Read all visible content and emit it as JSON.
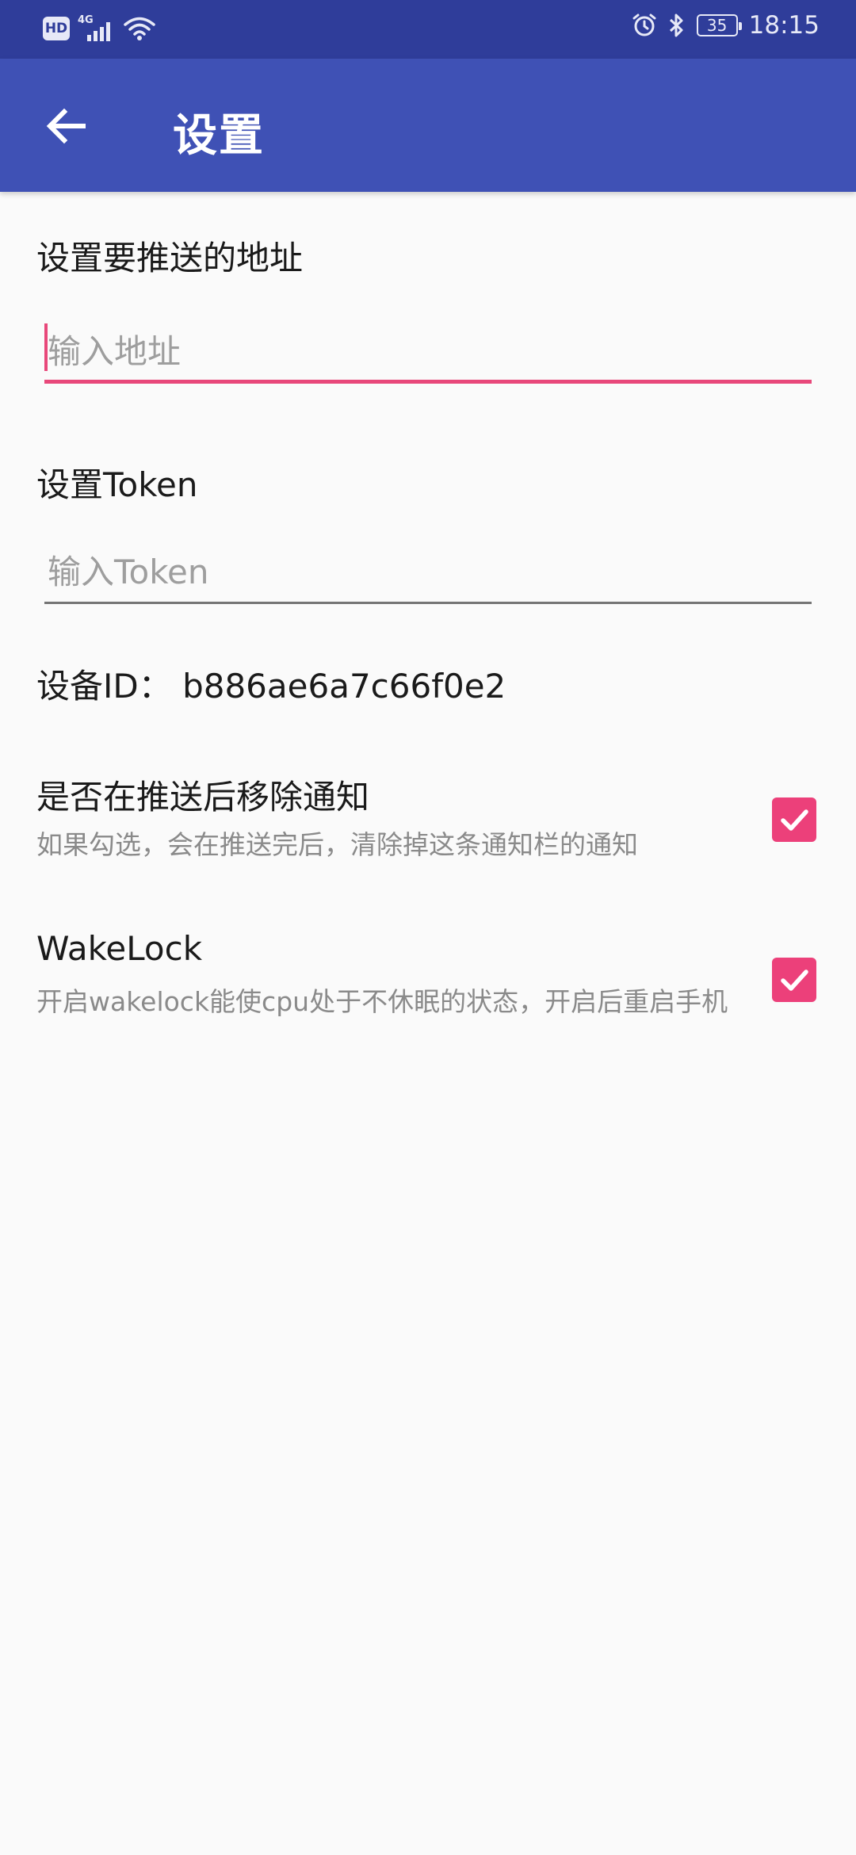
{
  "status_bar": {
    "hd": "HD",
    "network": "4G",
    "battery": "35",
    "time": "18:15",
    "icons": [
      "hd-icon",
      "signal-icon",
      "wifi-icon",
      "alarm-icon",
      "bluetooth-icon",
      "battery-icon"
    ]
  },
  "app_bar": {
    "title": "设置",
    "back_icon": "arrow-back-icon",
    "color": "#3f51b5"
  },
  "settings": {
    "address_label": "设置要推送的地址",
    "address_placeholder": "输入地址",
    "token_label": "设置Token",
    "token_placeholder": "输入Token",
    "device_id": "设备ID：  b886ae6a7c66f0e2",
    "remove_notification": {
      "title": "是否在推送后移除通知",
      "summary": "如果勾选，会在推送完后，清除掉这条通知栏的通知",
      "checked": true
    },
    "wakelock": {
      "title": "WakeLock",
      "summary": "开启wakelock能使cpu处于不休眠的状态，开启后重启手机",
      "checked": true
    }
  },
  "colors": {
    "accent": "#e8487a",
    "checkbox": "#ec407a",
    "status_bar": "#2f3d9a"
  }
}
